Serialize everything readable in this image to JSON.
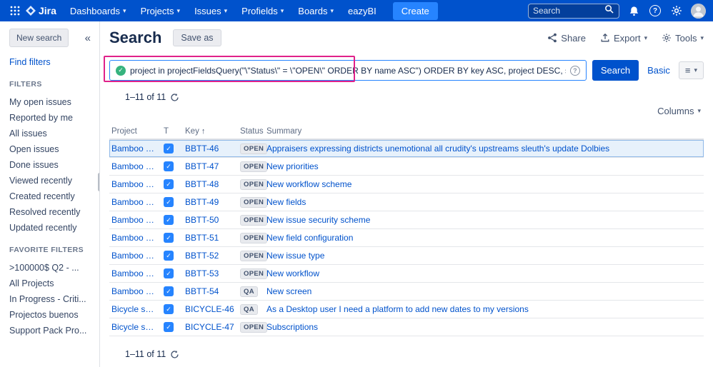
{
  "colors": {
    "nav_blue": "#0052CC",
    "create_blue": "#2684FF",
    "link_blue": "#0052CC",
    "annotation_pink": "#E0218A",
    "selected_row_blue": "#E7F1FB",
    "task_icon_blue": "#2684FF",
    "valid_query_green": "#36B37E"
  },
  "topnav": {
    "logo_text": "Jira",
    "menus": [
      {
        "label": "Dashboards",
        "caret": "▾"
      },
      {
        "label": "Projects",
        "caret": "▾"
      },
      {
        "label": "Issues",
        "caret": "▾"
      },
      {
        "label": "Profields",
        "caret": "▾"
      },
      {
        "label": "Boards",
        "caret": "▾"
      },
      {
        "label": "eazyBI",
        "caret": ""
      }
    ],
    "create_label": "Create",
    "search_placeholder": "Search"
  },
  "sidebar": {
    "new_search_label": "New search",
    "collapse_glyph": "«",
    "find_filters_label": "Find filters",
    "filters_heading": "FILTERS",
    "filters": [
      "My open issues",
      "Reported by me",
      "All issues",
      "Open issues",
      "Done issues",
      "Viewed recently",
      "Created recently",
      "Resolved recently",
      "Updated recently"
    ],
    "favorites_heading": "FAVORITE FILTERS",
    "favorites": [
      ">100000$ Q2 - ...",
      "All Projects",
      "In Progress - Criti...",
      "Projectos buenos",
      "Support Pack Pro..."
    ]
  },
  "header": {
    "title": "Search",
    "save_as_label": "Save as",
    "share_label": "Share",
    "export_label": "Export",
    "tools_label": "Tools",
    "caret": "▾"
  },
  "query_bar": {
    "query_highlighted": "project in projectFieldsQuery(\"\\\"Status\\\" = \\\"OPEN\\\" ORDER BY name ASC\")",
    "query_rest": " ORDER BY key ASC, project DESC, summary ASC",
    "search_label": "Search",
    "basic_label": "Basic",
    "switcher_glyph": "≡",
    "caret": "▾"
  },
  "results": {
    "count_text": "1–11 of 11",
    "columns_label": "Columns",
    "columns_caret": "▾",
    "table": {
      "headers": {
        "project": "Project",
        "type": "T",
        "key": "Key",
        "sort_arrow": "↑",
        "status": "Status",
        "summary": "Summary"
      },
      "rows": [
        {
          "project": "Bamboo Tea",
          "key": "BBTT-46",
          "status": "OPEN",
          "summary": "Appraisers expressing districts unemotional all crudity's upstreams sleuth's update Dolbies",
          "selected": true
        },
        {
          "project": "Bamboo Tea",
          "key": "BBTT-47",
          "status": "OPEN",
          "summary": "New priorities"
        },
        {
          "project": "Bamboo Tea",
          "key": "BBTT-48",
          "status": "OPEN",
          "summary": "New workflow scheme"
        },
        {
          "project": "Bamboo Tea",
          "key": "BBTT-49",
          "status": "OPEN",
          "summary": "New fields"
        },
        {
          "project": "Bamboo Tea",
          "key": "BBTT-50",
          "status": "OPEN",
          "summary": "New issue security scheme"
        },
        {
          "project": "Bamboo Tea",
          "key": "BBTT-51",
          "status": "OPEN",
          "summary": "New field configuration"
        },
        {
          "project": "Bamboo Tea",
          "key": "BBTT-52",
          "status": "OPEN",
          "summary": "New issue type"
        },
        {
          "project": "Bamboo Tea",
          "key": "BBTT-53",
          "status": "OPEN",
          "summary": "New workflow"
        },
        {
          "project": "Bamboo Tea",
          "key": "BBTT-54",
          "status": "QA",
          "summary": "New screen"
        },
        {
          "project": "Bicycle shop",
          "key": "BICYCLE-46",
          "status": "QA",
          "summary": "As a Desktop user I need a platform to add new dates to my versions"
        },
        {
          "project": "Bicycle shop",
          "key": "BICYCLE-47",
          "status": "OPEN",
          "summary": "Subscriptions"
        }
      ]
    }
  }
}
